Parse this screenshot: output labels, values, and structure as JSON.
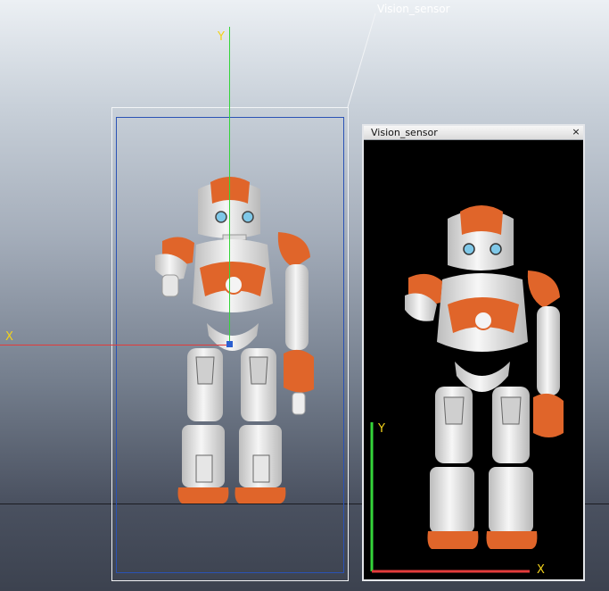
{
  "scene": {
    "object_label": "Vision_sensor",
    "axis_x_label": "X",
    "axis_y_label": "Y"
  },
  "floating_view": {
    "title": "Vision_sensor",
    "close_icon": "close-icon",
    "close_glyph": "×",
    "axis_x_label": "X",
    "axis_y_label": "Y"
  },
  "colors": {
    "x_axis": "#e23b3b",
    "y_axis": "#34d43a",
    "bbox_outer": "#f2f4f6",
    "bbox_inner": "#2a52b5",
    "robot_accent": "#e0652a",
    "robot_body": "#ececec",
    "axis_label": "#f2d21b"
  }
}
